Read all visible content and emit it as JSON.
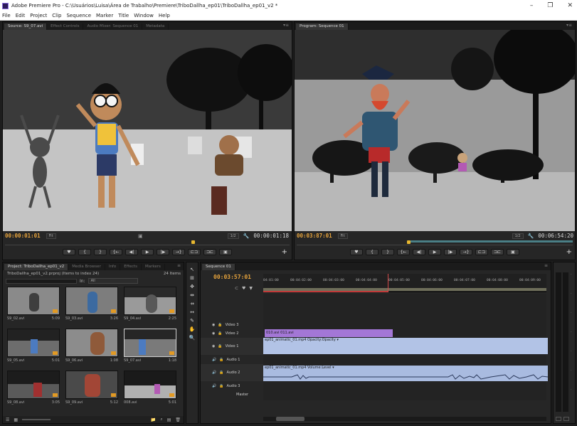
{
  "window": {
    "title": "Adobe Premiere Pro - C:\\Usuários\\Luisa\\Área de Trabalho\\Premiere\\TriboDallha_ep01\\TriboDallha_ep01_v2 *",
    "controls": [
      "–",
      "❐",
      "✕"
    ]
  },
  "menu": [
    "File",
    "Edit",
    "Project",
    "Clip",
    "Sequence",
    "Marker",
    "Title",
    "Window",
    "Help"
  ],
  "source_panel": {
    "tabs": [
      "Source: S9_07.avi",
      "Effect Controls",
      "Audio Mixer: Sequence 01",
      "Metadata"
    ],
    "timecode": "00:00:01:01",
    "fit": "Fit",
    "res": "1/2",
    "duration": "00:00:01:18"
  },
  "program_panel": {
    "tabs": [
      "Program: Sequence 01"
    ],
    "timecode": "00:03:87:01",
    "fit": "Fit",
    "res": "1/2",
    "duration": "00:06:54:20"
  },
  "transport_buttons": [
    "♥",
    "{",
    "}",
    "{←",
    "◀|",
    "▶",
    "|▶",
    "→}",
    "⊏⊐",
    "⊐⊏",
    "▣"
  ],
  "project_panel": {
    "tabs": [
      "Project: TriboDallha_ep01_v2",
      "Media Browser",
      "Info",
      "Effects",
      "Markers"
    ],
    "project_file": "TriboDallha_ep01_v2.prproj (Items to index 24)",
    "items_count": "24 Items",
    "in_label": "In:",
    "in_value": "All",
    "items": [
      {
        "name": "S9_02.avi",
        "duration": "5:09"
      },
      {
        "name": "S9_03.avi",
        "duration": "3:26"
      },
      {
        "name": "S9_04.avi",
        "duration": "2:25"
      },
      {
        "name": "S9_05.avi",
        "duration": "5:01"
      },
      {
        "name": "S9_06.avi",
        "duration": "1:08"
      },
      {
        "name": "S9_07.avi",
        "duration": "1:18"
      },
      {
        "name": "S9_08.avi",
        "duration": "3:05"
      },
      {
        "name": "S9_09.avi",
        "duration": "5:12"
      },
      {
        "name": "008.avi",
        "duration": "5:01"
      }
    ]
  },
  "sequence_panel": {
    "tabs": [
      "Sequence 01"
    ],
    "timecode": "00:03:57:01",
    "ruler": [
      "04:01:00",
      "00:04:02:00",
      "00:04:03:00",
      "00:04:04:00",
      "00:04:05:00",
      "00:04:06:00",
      "00:04:07:00",
      "00:04:08:00",
      "00:04:09:00"
    ],
    "tracks": [
      {
        "name": "Video 3"
      },
      {
        "name": "Video 2"
      },
      {
        "name": "Video 1"
      },
      {
        "name": "Audio 1"
      },
      {
        "name": "Audio 2"
      },
      {
        "name": "Audio 3"
      },
      {
        "name": "Master"
      }
    ],
    "clips": {
      "video2": "010.avi  011.avi",
      "video1": "ep01_animatic_01.mp4  Opacity:Opacity ▾",
      "audio2": "ep01_animatic_01.mp4  Volume:Level ▾"
    }
  },
  "tools": [
    "↖",
    "⊞",
    "✥",
    "⇹",
    "⇸",
    "↔",
    "✎",
    "✋",
    "🔍"
  ],
  "colors": {
    "timecode": "#e6a33c",
    "video_clip": "#b2c3e6",
    "audio_clip": "#a9bbe0",
    "purple_clip": "#a377d6",
    "playhead_marker": "#e8b830"
  }
}
